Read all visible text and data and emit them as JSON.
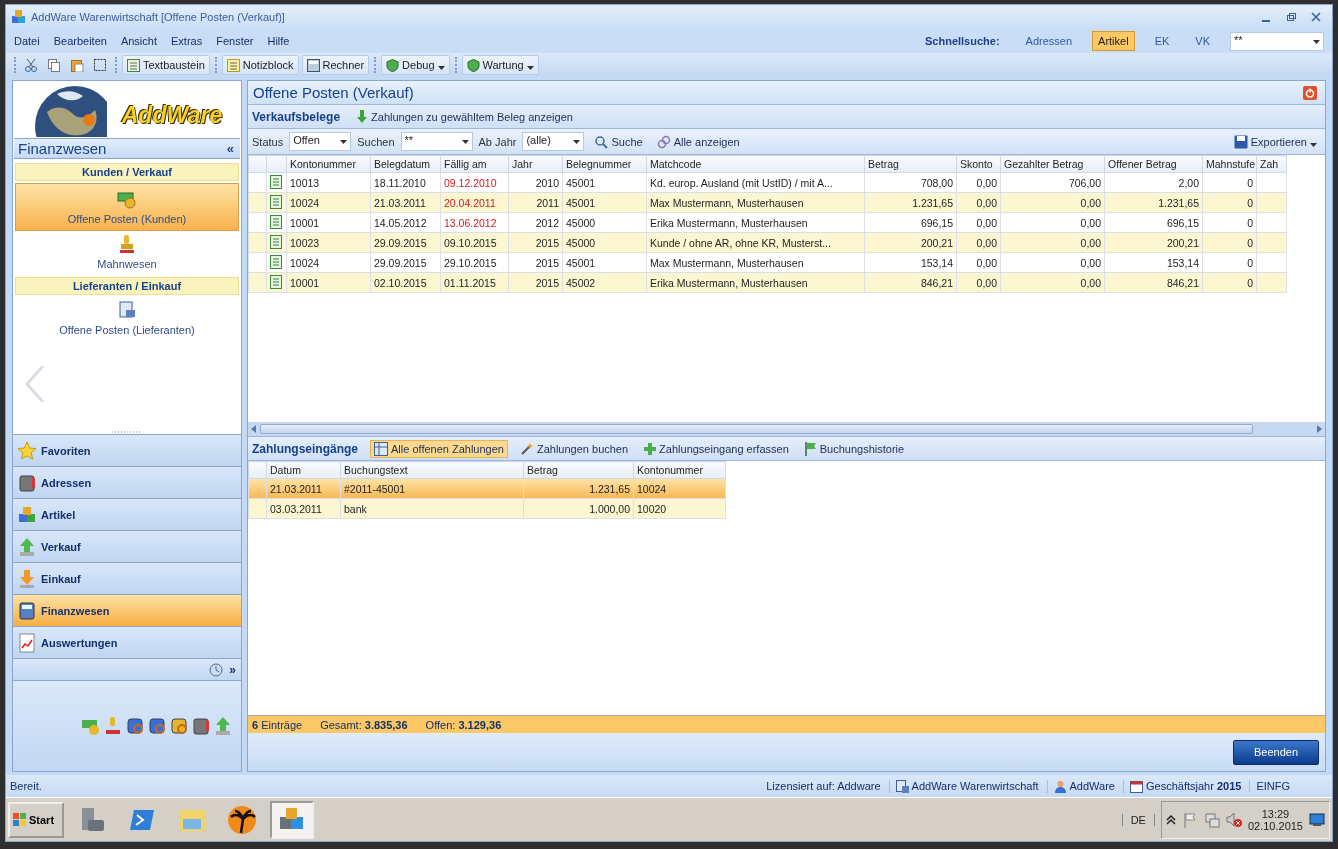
{
  "window": {
    "title": "AddWare Warenwirtschaft [Offene Posten (Verkauf)]"
  },
  "menu": [
    "Datei",
    "Bearbeiten",
    "Ansicht",
    "Extras",
    "Fenster",
    "Hilfe"
  ],
  "quick_search": {
    "label": "Schnellsuche:",
    "options": [
      {
        "label": "Adressen",
        "selected": false
      },
      {
        "label": "Artikel",
        "selected": true
      },
      {
        "label": "EK",
        "selected": false
      },
      {
        "label": "VK",
        "selected": false
      }
    ],
    "value": "**"
  },
  "toolbar": [
    {
      "label": "Textbaustein",
      "dropdown": false
    },
    {
      "label": "Notizblock",
      "dropdown": false
    },
    {
      "label": "Rechner",
      "dropdown": false
    },
    {
      "label": "Debug",
      "dropdown": true
    },
    {
      "label": "Wartung",
      "dropdown": true
    }
  ],
  "sidebar": {
    "logo": "AddWare",
    "title": "Finanzwesen",
    "collapse": "«",
    "sections": [
      {
        "title": "Kunden / Verkauf",
        "items": [
          {
            "label": "Offene Posten (Kunden)",
            "selected": true
          },
          {
            "label": "Mahnwesen",
            "selected": false
          }
        ]
      },
      {
        "title": "Lieferanten / Einkauf",
        "items": [
          {
            "label": "Offene Posten (Lieferanten)",
            "selected": false
          }
        ]
      }
    ],
    "nav": [
      {
        "label": "Favoriten",
        "selected": false
      },
      {
        "label": "Adressen",
        "selected": false
      },
      {
        "label": "Artikel",
        "selected": false
      },
      {
        "label": "Verkauf",
        "selected": false
      },
      {
        "label": "Einkauf",
        "selected": false
      },
      {
        "label": "Finanzwesen",
        "selected": true
      },
      {
        "label": "Auswertungen",
        "selected": false
      }
    ],
    "more": "»"
  },
  "panel": {
    "title": "Offene Posten (Verkauf)",
    "section": "Verkaufsbelege",
    "action": "Zahlungen zu gewähltem Beleg anzeigen",
    "filters": [
      {
        "label": "Status",
        "value": "Offen"
      },
      {
        "label": "Suchen",
        "value": "**"
      },
      {
        "label": "Ab Jahr",
        "value": "(alle)"
      }
    ],
    "search_button": "Suche",
    "show_all_button": "Alle anzeigen",
    "export_button": "Exportieren"
  },
  "table": {
    "columns": [
      {
        "label": "Kontonummer",
        "kind": "text"
      },
      {
        "label": "Belegdatum",
        "kind": "text"
      },
      {
        "label": "Fällig am",
        "kind": "text"
      },
      {
        "label": "Jahr",
        "kind": "number"
      },
      {
        "label": "Belegnummer",
        "kind": "text"
      },
      {
        "label": "Matchcode",
        "kind": "text"
      },
      {
        "label": "Betrag",
        "kind": "number"
      },
      {
        "label": "Skonto",
        "kind": "number"
      },
      {
        "label": "Gezahlter Betrag",
        "kind": "number"
      },
      {
        "label": "Offener Betrag",
        "kind": "number"
      },
      {
        "label": "Mahnstufe",
        "kind": "number"
      },
      {
        "label": "Zah",
        "kind": "text"
      }
    ],
    "rows": [
      {
        "overdue": true,
        "cells": [
          "10013",
          "18.11.2010",
          "09.12.2010",
          "2010",
          "45001",
          "Kd. europ. Ausland (mit UstID) / mit A...",
          "708,00",
          "0,00",
          "706,00",
          "2,00",
          "0"
        ]
      },
      {
        "overdue": true,
        "cells": [
          "10024",
          "21.03.2011",
          "20.04.2011",
          "2011",
          "45001",
          "Max Mustermann, Musterhausen",
          "1.231,65",
          "0,00",
          "0,00",
          "1.231,65",
          "0"
        ]
      },
      {
        "overdue": true,
        "cells": [
          "10001",
          "14.05.2012",
          "13.06.2012",
          "2012",
          "45000",
          "Erika Mustermann, Musterhausen",
          "696,15",
          "0,00",
          "0,00",
          "696,15",
          "0"
        ]
      },
      {
        "overdue": false,
        "cells": [
          "10023",
          "29.09.2015",
          "09.10.2015",
          "2015",
          "45000",
          "Kunde / ohne AR, ohne KR, Musterst...",
          "200,21",
          "0,00",
          "0,00",
          "200,21",
          "0"
        ]
      },
      {
        "overdue": false,
        "cells": [
          "10024",
          "29.09.2015",
          "29.10.2015",
          "2015",
          "45001",
          "Max Mustermann, Musterhausen",
          "153,14",
          "0,00",
          "0,00",
          "153,14",
          "0"
        ]
      },
      {
        "overdue": false,
        "cells": [
          "10001",
          "02.10.2015",
          "01.11.2015",
          "2015",
          "45002",
          "Erika Mustermann, Musterhausen",
          "846,21",
          "0,00",
          "0,00",
          "846,21",
          "0"
        ]
      }
    ]
  },
  "payments": {
    "title": "Zahlungseingänge",
    "tabs": [
      {
        "label": "Alle offenen Zahlungen",
        "selected": true
      },
      {
        "label": "Zahlungen buchen",
        "selected": false
      },
      {
        "label": "Zahlungseingang erfassen",
        "selected": false
      },
      {
        "label": "Buchungshistorie",
        "selected": false
      }
    ],
    "columns": [
      {
        "label": "Datum",
        "kind": "text"
      },
      {
        "label": "Buchungstext",
        "kind": "text"
      },
      {
        "label": "Betrag",
        "kind": "number"
      },
      {
        "label": "Kontonummer",
        "kind": "text"
      }
    ],
    "rows": [
      {
        "selected": true,
        "cells": [
          "21.03.2011",
          "#2011-45001",
          "1.231,65",
          "10024"
        ]
      },
      {
        "selected": false,
        "cells": [
          "03.03.2011",
          "bank",
          "1.000,00",
          "10020"
        ]
      }
    ]
  },
  "summary": [
    "**6** Einträge",
    "Gesamt: **3.835,36**",
    "Offen: **3.129,36**"
  ],
  "close_button": "Beenden",
  "status_bar": {
    "message": "Bereit.",
    "license": "Lizensiert auf: Addware",
    "app": "AddWare Warenwirtschaft",
    "user": "AddWare",
    "year": "Geschäftsjahr **2015**",
    "mode": "EINFG"
  },
  "taskbar": {
    "start": "Start",
    "language": "DE",
    "time": "13:29",
    "date": "02.10.2015"
  }
}
